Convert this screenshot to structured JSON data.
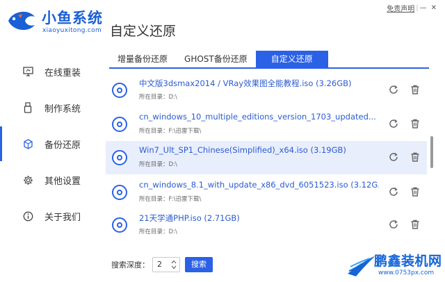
{
  "brand": {
    "name": "小鱼系统",
    "domain": "xiaoyuxitong.com",
    "color": "#1a5fd6"
  },
  "page_title": "自定义还原",
  "top_links": {
    "disclaimer": "免责声明",
    "separator": "|",
    "minimize": "—",
    "close": "✕"
  },
  "sidebar": {
    "items": [
      {
        "label": "在线重装",
        "icon": "monitor-icon",
        "active": false
      },
      {
        "label": "制作系统",
        "icon": "usb-drive-icon",
        "active": false
      },
      {
        "label": "备份还原",
        "icon": "backup-icon",
        "active": true
      },
      {
        "label": "其他设置",
        "icon": "gear-icon",
        "active": false
      },
      {
        "label": "关于我们",
        "icon": "info-icon",
        "active": false
      }
    ]
  },
  "tabs": [
    {
      "label": "增量备份还原",
      "active": false
    },
    {
      "label": "GHOST备份还原",
      "active": false
    },
    {
      "label": "自定义还原",
      "active": true
    }
  ],
  "dir_label": "所在目录：",
  "files": [
    {
      "name": "中文版3dsmax2014 / VRay效果图全能教程.iso (3.26GB)",
      "dir": "D:\\",
      "selected": false
    },
    {
      "name": "cn_windows_10_multiple_editions_version_1703_updated...",
      "dir": "F:\\迅雷下载\\",
      "selected": false
    },
    {
      "name": "Win7_Ult_SP1_Chinese(Simplified)_x64.iso (3.19GB)",
      "dir": "D:\\",
      "selected": true
    },
    {
      "name": "cn_windows_8.1_with_update_x86_dvd_6051523.iso (3.12G...",
      "dir": "F:\\迅雷下载\\",
      "selected": false
    },
    {
      "name": "21天学通PHP.iso (2.71GB)",
      "dir": "D:\\",
      "selected": false
    }
  ],
  "search": {
    "depth_label": "搜索深度：",
    "depth_value": "2",
    "button_label": "搜索"
  },
  "watermark": {
    "title": "鹏鑫装机网",
    "url": "www.0753px.com"
  },
  "colors": {
    "accent": "#2b61e6",
    "selected_row": "#e9eefd",
    "link_text": "#2b5bd0"
  }
}
